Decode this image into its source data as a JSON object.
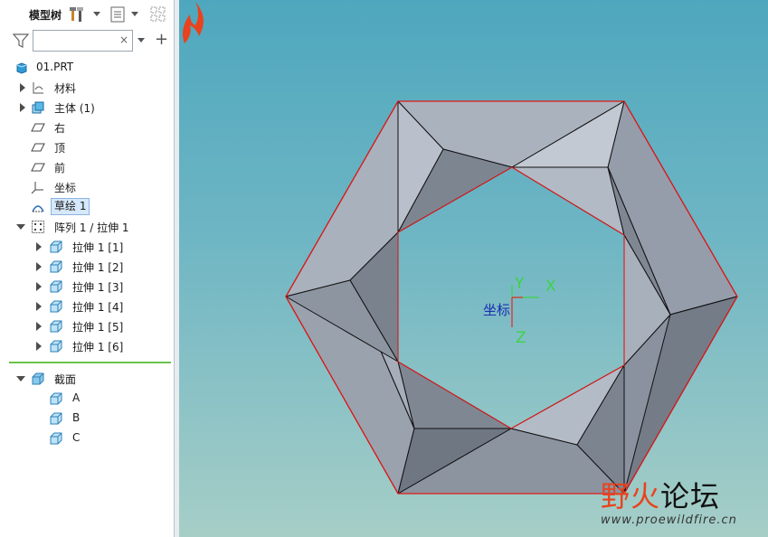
{
  "panel": {
    "title": "模型树",
    "search": {
      "value": "",
      "placeholder": ""
    },
    "clear": "×",
    "add": "+"
  },
  "tree": {
    "root": "01.PRT",
    "items": [
      {
        "label": "材料",
        "icon": "material-icon"
      },
      {
        "label": "主体 (1)",
        "icon": "body-icon"
      },
      {
        "label": "右",
        "icon": "datum-plane-icon"
      },
      {
        "label": "顶",
        "icon": "datum-plane-icon"
      },
      {
        "label": "前",
        "icon": "datum-plane-icon"
      },
      {
        "label": "坐标",
        "icon": "coordinate-system-icon"
      },
      {
        "label": "草绘 1",
        "icon": "sketch-icon"
      },
      {
        "label": "阵列 1 / 拉伸 1",
        "icon": "pattern-icon"
      },
      {
        "label": "拉伸 1 [1]",
        "icon": "extrude-icon"
      },
      {
        "label": "拉伸 1 [2]",
        "icon": "extrude-icon"
      },
      {
        "label": "拉伸 1 [3]",
        "icon": "extrude-icon"
      },
      {
        "label": "拉伸 1 [4]",
        "icon": "extrude-icon"
      },
      {
        "label": "拉伸 1 [5]",
        "icon": "extrude-icon"
      },
      {
        "label": "拉伸 1 [6]",
        "icon": "extrude-icon"
      }
    ],
    "sections": {
      "label": "截面",
      "items": [
        "A",
        "B",
        "C"
      ]
    }
  },
  "viewport": {
    "csys_label": "坐标",
    "axis_x": "X",
    "axis_y": "Y",
    "axis_z": "Z"
  },
  "watermark": {
    "brand_red": "野火",
    "brand_black": "论坛",
    "url": "www.proewildfire.cn"
  },
  "colors": {
    "selection": "#d6e8fb",
    "separator": "#6cc24a",
    "edge": "#e01818",
    "axis": "#3fd24a",
    "csys_label": "#1a2fb0"
  }
}
